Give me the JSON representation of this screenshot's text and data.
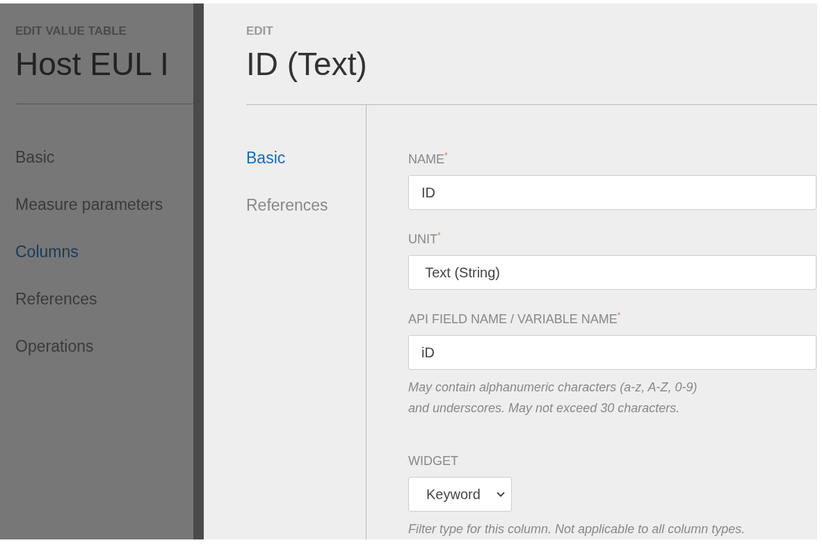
{
  "background_panel": {
    "eyebrow": "EDIT VALUE TABLE",
    "title": "Host EUL I",
    "nav": [
      {
        "label": "Basic",
        "selected": false
      },
      {
        "label": "Measure parameters",
        "selected": false
      },
      {
        "label": "Columns",
        "selected": true
      },
      {
        "label": "References",
        "selected": false
      },
      {
        "label": "Operations",
        "selected": false
      }
    ]
  },
  "edit_panel": {
    "eyebrow": "EDIT",
    "title": "ID (Text)",
    "nav": [
      {
        "label": "Basic",
        "selected": true
      },
      {
        "label": "References",
        "selected": false
      }
    ],
    "fields": [
      {
        "kind": "input",
        "label": "NAME$^{*}$",
        "value": "ID"
      },
      {
        "kind": "input",
        "label": "UNIT$^{*}$",
        "value": " Text (String)"
      },
      {
        "kind": "input",
        "label": "API FIELD NAME / VARIABLE NAME$^{*}$",
        "value": "iD",
        "hints": [
          "May contain alphanumeric characters (a-z, A-Z, 0-9)",
          "and underscores. May not exceed 30 characters."
        ]
      },
      {
        "kind": "select",
        "label": "WIDGET",
        "value": "Keyword",
        "hints": [
          "Filter type for this column. Not applicable to all column types."
        ]
      }
    ]
  }
}
